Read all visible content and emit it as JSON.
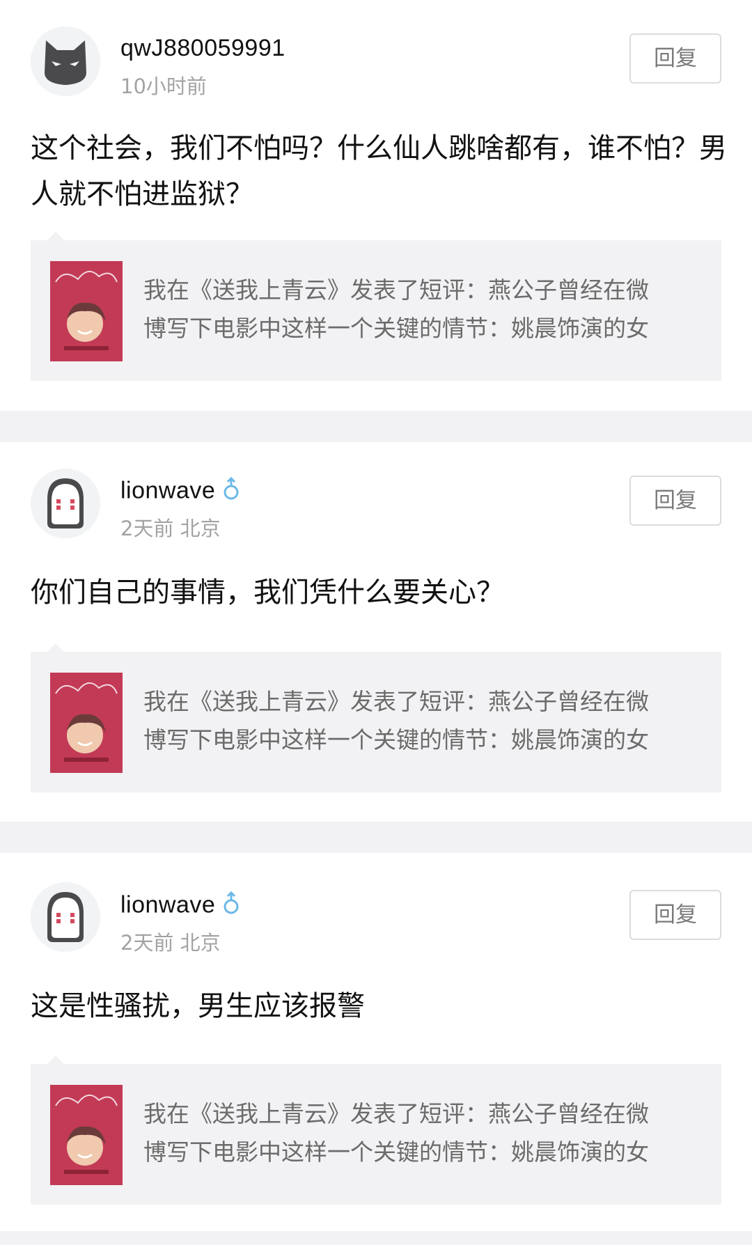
{
  "comments": [
    {
      "username": "qwJ880059991",
      "meta": "10小时前",
      "reply_label": "回复",
      "text": "这个社会，我们不怕吗？什么仙人跳啥都有，谁不怕？男人就不怕进监狱？",
      "avatar_icon": "black-panther-mask-icon",
      "gender": null,
      "ref": {
        "line1": "我在《送我上青云》发表了短评：燕公子曾经在微",
        "line2": "博写下电影中这样一个关键的情节：姚晨饰演的女"
      }
    },
    {
      "username": "lionwave",
      "meta": "2天前 北京",
      "reply_label": "回复",
      "text": "你们自己的事情，我们凭什么要关心？",
      "avatar_icon": "no-face-mask-icon",
      "gender": "male-icon",
      "ref": {
        "line1": "我在《送我上青云》发表了短评：燕公子曾经在微",
        "line2": "博写下电影中这样一个关键的情节：姚晨饰演的女"
      }
    },
    {
      "username": "lionwave",
      "meta": "2天前 北京",
      "reply_label": "回复",
      "text": "这是性骚扰，男生应该报警",
      "avatar_icon": "no-face-mask-icon",
      "gender": "male-icon",
      "ref": {
        "line1": "我在《送我上青云》发表了短评：燕公子曾经在微",
        "line2": "博写下电影中这样一个关键的情节：姚晨饰演的女"
      }
    }
  ],
  "colors": {
    "gender_icon": "#6bb8e8",
    "meta_text": "#a3a3a3",
    "card_bg": "#f2f2f4",
    "poster_red": "#c23a55"
  }
}
